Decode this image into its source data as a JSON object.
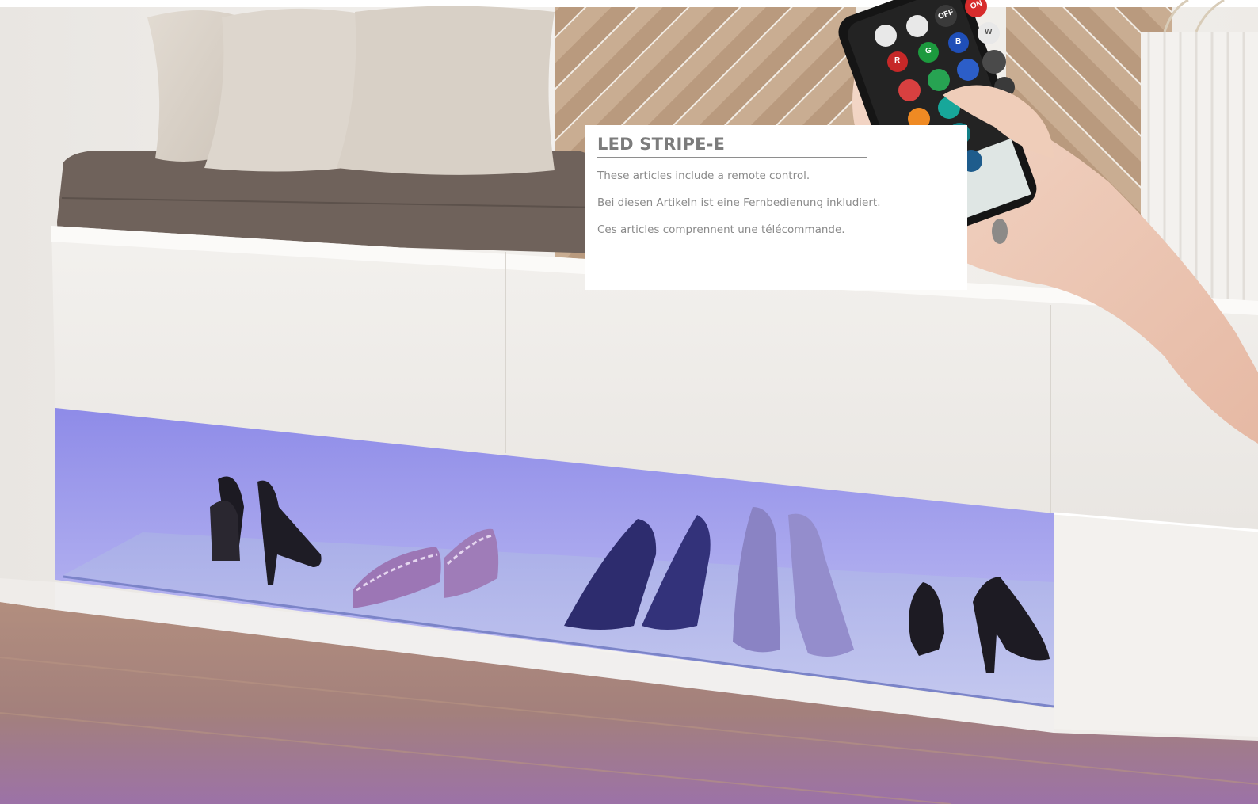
{
  "info_card": {
    "title": "LED STRIPE-E",
    "lines": [
      "These articles include a remote control.",
      "Bei diesen Artikeln ist eine Fernbedienung inkludiert.",
      "Ces articles comprennent une télécommande."
    ]
  },
  "remote": {
    "off_label": "OFF",
    "on_label": "ON",
    "r_label": "R",
    "g_label": "G",
    "b_label": "B",
    "w_label": "W"
  },
  "colors": {
    "led_glow": "#a7a4f0",
    "floor": "#a07a7a",
    "cabinet": "#f1efec",
    "cushion": "#6f625b"
  }
}
